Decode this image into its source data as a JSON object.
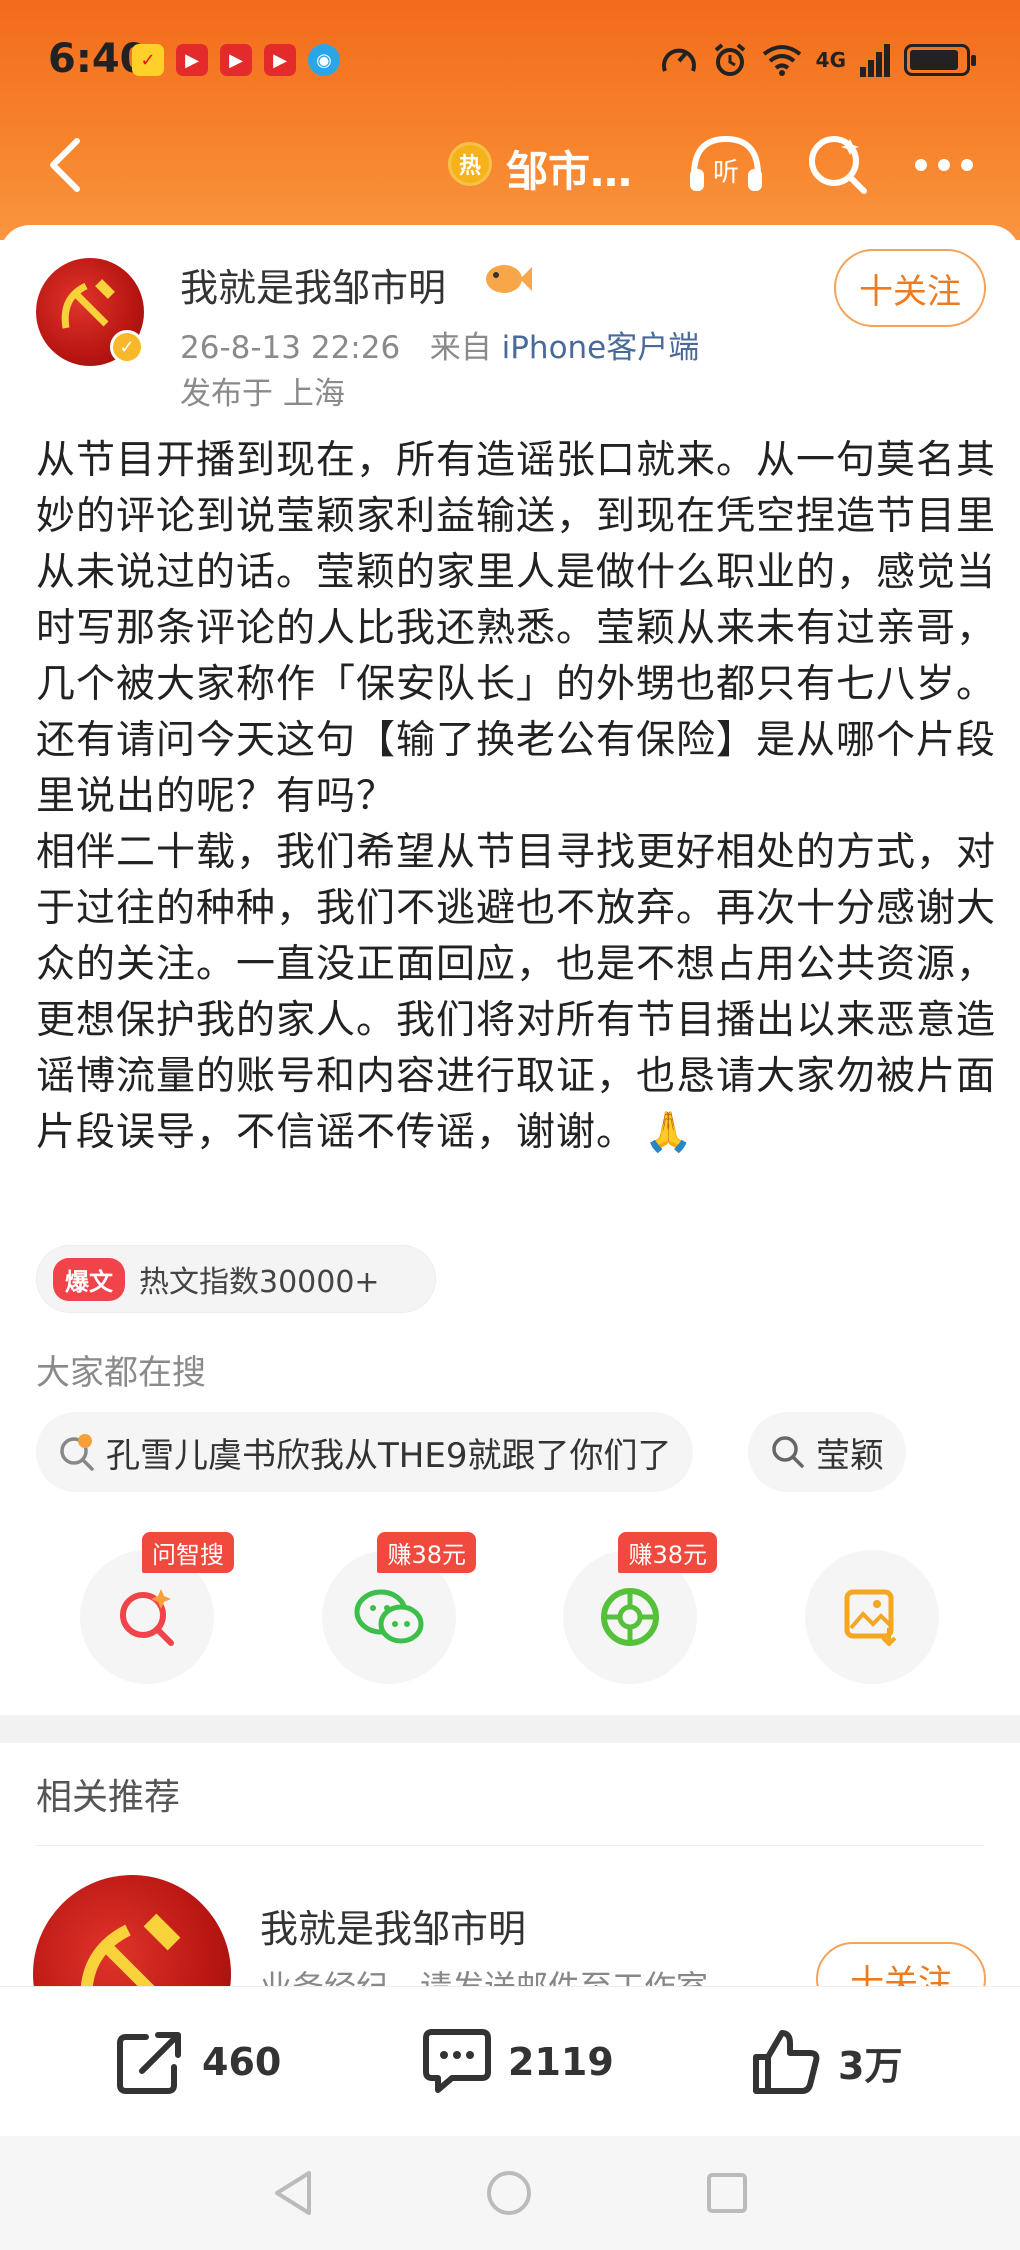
{
  "status_bar": {
    "time": "6:40",
    "network": "4G",
    "app_icons": [
      "weibo-red-icon",
      "video-app-icon",
      "video-app-icon",
      "video-app-icon",
      "browser-blue-icon"
    ]
  },
  "nav": {
    "hot_badge": "热",
    "title": "邹市…",
    "listen_label": "听"
  },
  "post": {
    "author": "我就是我邹市明",
    "time": "26-8-13 22:26",
    "source_prefix": "来自",
    "source": "iPhone客户端",
    "location": "发布于 上海",
    "follow_label": "十关注",
    "text": "从节目开播到现在，所有造谣张口就来。从一句莫名其妙的评论到说莹颖家利益输送，到现在凭空捏造节目里从未说过的话。莹颖的家里人是做什么职业的，感觉当时写那条评论的人比我还熟悉。莹颖从来未有过亲哥，几个被大家称作「保安队长」的外甥也都只有七八岁。还有请问今天这句【输了换老公有保险】是从哪个片段里说出的呢？有吗？\n相伴二十载，我们希望从节目寻找更好相处的方式，对于过往的种种，我们不逃避也不放弃。再次十分感谢大众的关注。一直没正面回应，也是不想占用公共资源，更想保护我的家人。我们将对所有节目播出以来恶意造谣博流量的账号和内容进行取证，也恳请大家勿被片面片段误导，不信谣不传谣，谢谢。",
    "emoji": "🙏",
    "hot_tag": "爆文",
    "hot_index": "热文指数30000+"
  },
  "search": {
    "heading": "大家都在搜",
    "chips": [
      {
        "label": "孔雪儿虞书欣我从THE9就跟了你们了",
        "icon": "hot-search-icon"
      },
      {
        "label": "莹颖",
        "icon": "search-icon"
      }
    ]
  },
  "actions": [
    {
      "name": "ai-search",
      "tag": "问智搜",
      "icon": "ai-search-icon",
      "color": "#f0434a"
    },
    {
      "name": "wechat-share",
      "tag": "赚38元",
      "icon": "wechat-icon",
      "color": "#3cbf4a"
    },
    {
      "name": "moments-share",
      "tag": "赚38元",
      "icon": "moments-icon",
      "color": "#55c13a"
    },
    {
      "name": "save-image",
      "tag": "",
      "icon": "image-download-icon",
      "color": "#f5a623"
    }
  ],
  "related": {
    "title": "相关推荐",
    "name": "我就是我邹市明",
    "desc": "业务经纪，请发送邮件至工作室",
    "follow_label": "十关注"
  },
  "bottom_bar": {
    "share_count": "460",
    "comment_count": "2119",
    "like_count": "3万"
  },
  "colors": {
    "header_orange": "#f36b1c",
    "accent_orange": "#f07a1e",
    "link_blue": "#4a6a99",
    "badge_red": "#f04a3e"
  }
}
